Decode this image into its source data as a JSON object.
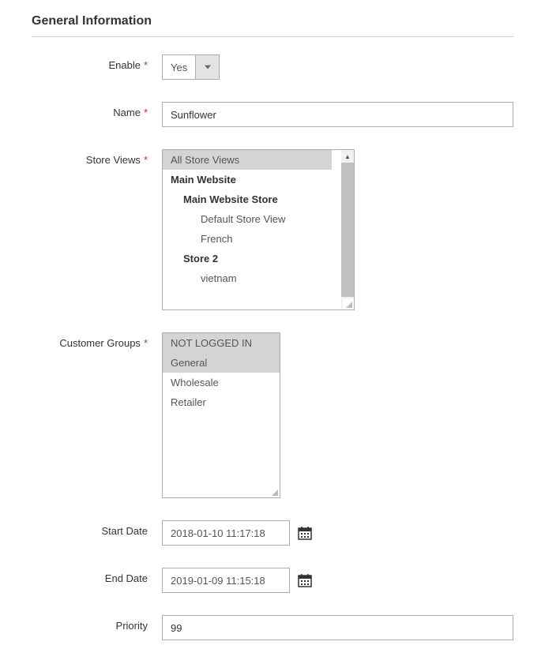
{
  "section_title": "General Information",
  "fields": {
    "enable": {
      "label": "Enable",
      "value": "Yes"
    },
    "name": {
      "label": "Name",
      "value": "Sunflower"
    },
    "store_views": {
      "label": "Store Views",
      "items": [
        {
          "text": "All Store Views",
          "type": "item",
          "selected": true,
          "indent": 0
        },
        {
          "text": "Main Website",
          "type": "group",
          "indent": 0
        },
        {
          "text": "Main Website Store",
          "type": "group",
          "indent": 1
        },
        {
          "text": "Default Store View",
          "type": "item",
          "indent": 2
        },
        {
          "text": "French",
          "type": "item",
          "indent": 2
        },
        {
          "text": "Store 2",
          "type": "group",
          "indent": 1
        },
        {
          "text": "vietnam",
          "type": "item",
          "indent": 2
        }
      ]
    },
    "customer_groups": {
      "label": "Customer Groups",
      "items": [
        {
          "text": "NOT LOGGED IN",
          "selected": true
        },
        {
          "text": "General",
          "selected": true
        },
        {
          "text": "Wholesale",
          "selected": false
        },
        {
          "text": "Retailer",
          "selected": false
        }
      ]
    },
    "start_date": {
      "label": "Start Date",
      "value": "2018-01-10 11:17:18"
    },
    "end_date": {
      "label": "End Date",
      "value": "2019-01-09 11:15:18"
    },
    "priority": {
      "label": "Priority",
      "value": "99"
    }
  }
}
